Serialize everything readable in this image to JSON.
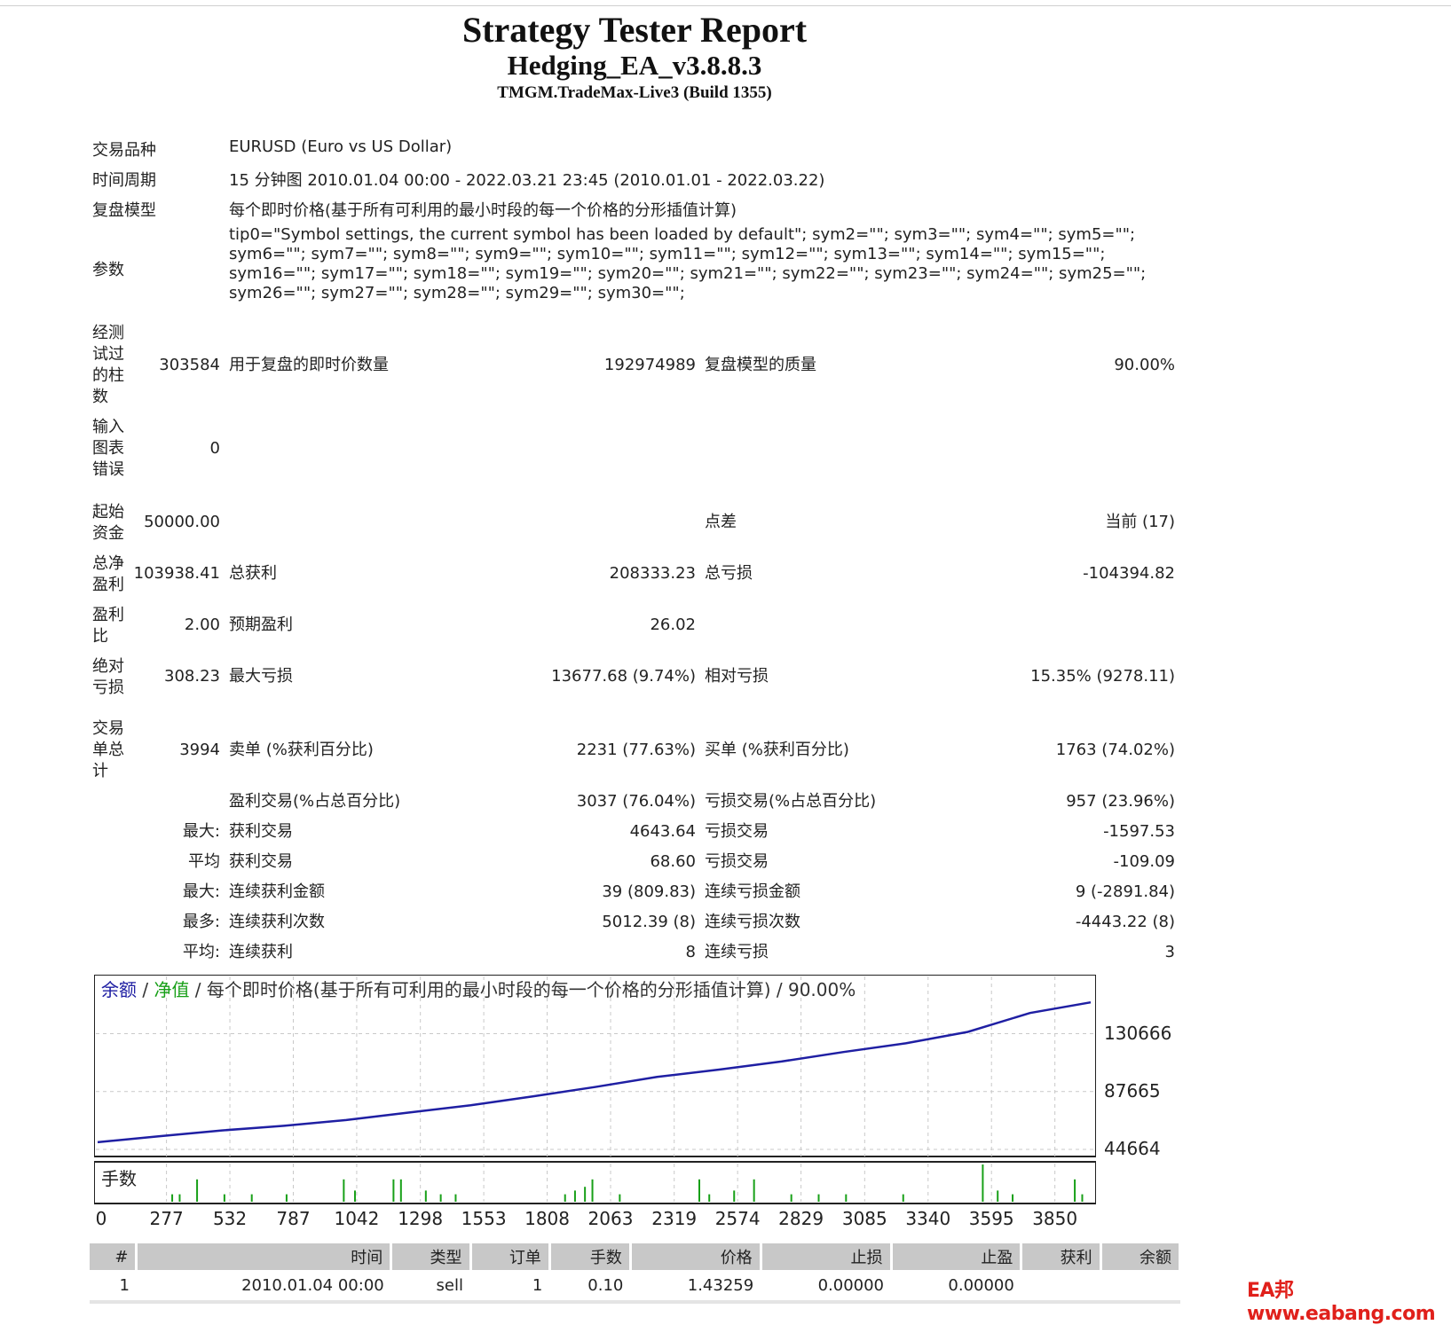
{
  "report": {
    "title": "Strategy Tester Report",
    "ea_name": "Hedging_EA_v3.8.8.3",
    "server": "TMGM.TradeMax-Live3 (Build 1355)"
  },
  "info": {
    "symbol_label": "交易品种",
    "symbol_value": "EURUSD (Euro vs US Dollar)",
    "period_label": "时间周期",
    "period_value": "15 分钟图 2010.01.04 00:00 - 2022.03.21 23:45 (2010.01.01 - 2022.03.22)",
    "model_label": "复盘模型",
    "model_value": "每个即时价格(基于所有可利用的最小时段的每一个价格的分形插值计算)",
    "params_label": "参数",
    "params_value": "tip0=\"Symbol settings, the current symbol has been loaded by default\"; sym2=\"\"; sym3=\"\"; sym4=\"\"; sym5=\"\"; sym6=\"\"; sym7=\"\"; sym8=\"\"; sym9=\"\"; sym10=\"\"; sym11=\"\"; sym12=\"\"; sym13=\"\"; sym14=\"\"; sym15=\"\"; sym16=\"\"; sym17=\"\"; sym18=\"\"; sym19=\"\"; sym20=\"\"; sym21=\"\"; sym22=\"\"; sym23=\"\"; sym24=\"\"; sym25=\"\"; sym26=\"\"; sym27=\"\"; sym28=\"\"; sym29=\"\"; sym30=\"\";"
  },
  "stats": {
    "bars_label": "经测试过的柱数",
    "bars_value": "303584",
    "ticks_label": "用于复盘的即时价数量",
    "ticks_value": "192974989",
    "quality_label": "复盘模型的质量",
    "quality_value": "90.00%",
    "errors_label": "输入图表错误",
    "errors_value": "0",
    "deposit_label": "起始资金",
    "deposit_value": "50000.00",
    "spread_label": "点差",
    "spread_value": "当前 (17)",
    "net_label": "总净盈利",
    "net_value": "103938.41",
    "gross_profit_label": "总获利",
    "gross_profit_value": "208333.23",
    "gross_loss_label": "总亏损",
    "gross_loss_value": "-104394.82",
    "pf_label": "盈利比",
    "pf_value": "2.00",
    "expected_label": "预期盈利",
    "expected_value": "26.02",
    "abs_dd_label": "绝对亏损",
    "abs_dd_value": "308.23",
    "max_dd_label": "最大亏损",
    "max_dd_value": "13677.68 (9.74%)",
    "rel_dd_label": "相对亏损",
    "rel_dd_value": "15.35% (9278.11)",
    "total_trades_label": "交易单总计",
    "total_trades_value": "3994",
    "short_label": "卖单 (%获利百分比)",
    "short_value": "2231 (77.63%)",
    "long_label": "买单 (%获利百分比)",
    "long_value": "1763 (74.02%)",
    "profit_trades_label": "盈利交易(%占总百分比)",
    "profit_trades_value": "3037 (76.04%)",
    "loss_trades_label": "亏损交易(%占总百分比)",
    "loss_trades_value": "957 (23.96%)",
    "largest_prefix": "最大:",
    "largest_profit_label": "获利交易",
    "largest_profit_value": "4643.64",
    "largest_loss_label": "亏损交易",
    "largest_loss_value": "-1597.53",
    "average_prefix": "平均",
    "average_profit_label": "获利交易",
    "average_profit_value": "68.60",
    "average_loss_label": "亏损交易",
    "average_loss_value": "-109.09",
    "max_consec_prefix": "最大:",
    "max_consec_wins_label": "连续获利金额",
    "max_consec_wins_value": "39 (809.83)",
    "max_consec_losses_label": "连续亏损金额",
    "max_consec_losses_value": "9 (-2891.84)",
    "maximal_prefix": "最多:",
    "maximal_wins_label": "连续获利次数",
    "maximal_wins_value": "5012.39 (8)",
    "maximal_losses_label": "连续亏损次数",
    "maximal_losses_value": "-4443.22 (8)",
    "avg_consec_prefix": "平均:",
    "avg_consec_wins_label": "连续获利",
    "avg_consec_wins_value": "8",
    "avg_consec_losses_label": "连续亏损",
    "avg_consec_losses_value": "3"
  },
  "chart_data": {
    "type": "line",
    "legend_balance": "余额",
    "legend_sep1": " / ",
    "legend_equity": "净值",
    "legend_rest": " / 每个即时价格(基于所有可利用的最小时段的每一个价格的分形插值计算) / 90.00%",
    "volume_label": "手数",
    "y_ticks": [
      "130666",
      "87665",
      "44664"
    ],
    "x_ticks": [
      "0",
      "277",
      "532",
      "787",
      "1042",
      "1298",
      "1553",
      "1808",
      "2063",
      "2319",
      "2574",
      "2829",
      "3085",
      "3340",
      "3595",
      "3850"
    ],
    "ylim": [
      44664,
      160000
    ],
    "xlim": [
      0,
      3994
    ],
    "grid": true,
    "balance_color": "#1f1fa3",
    "equity_color": "#18a018",
    "volume_color": "#18a018",
    "series": [
      {
        "name": "余额",
        "x": [
          0,
          250,
          500,
          750,
          1000,
          1250,
          1500,
          1750,
          2000,
          2250,
          2500,
          2750,
          3000,
          3250,
          3500,
          3750,
          3994
        ],
        "values": [
          50000,
          54500,
          58800,
          62200,
          66500,
          72000,
          77500,
          84000,
          91000,
          98500,
          104000,
          110000,
          117000,
          123500,
          132000,
          146000,
          153938
        ]
      }
    ],
    "volume": {
      "x": [
        300,
        330,
        400,
        510,
        620,
        760,
        990,
        1035,
        1190,
        1220,
        1320,
        1380,
        1440,
        1880,
        1920,
        1960,
        1990,
        2100,
        2420,
        2460,
        2560,
        2640,
        2790,
        2900,
        3010,
        3240,
        3560,
        3620,
        3680,
        3930,
        3960
      ],
      "values": [
        0.2,
        0.2,
        0.6,
        0.2,
        0.2,
        0.2,
        0.6,
        0.3,
        0.6,
        0.6,
        0.3,
        0.2,
        0.2,
        0.2,
        0.3,
        0.4,
        0.6,
        0.2,
        0.6,
        0.2,
        0.3,
        0.6,
        0.2,
        0.2,
        0.2,
        0.2,
        1.0,
        0.3,
        0.2,
        0.6,
        0.2
      ],
      "ymax": 1.0
    }
  },
  "trades": {
    "headers": [
      "#",
      "时间",
      "类型",
      "订单",
      "手数",
      "价格",
      "止损",
      "止盈",
      "获利",
      "余额"
    ],
    "rows": [
      [
        "1",
        "2010.01.04 00:00",
        "sell",
        "1",
        "0.10",
        "1.43259",
        "0.00000",
        "0.00000",
        "",
        ""
      ]
    ]
  },
  "watermark": "EA邦www.eabang.com"
}
